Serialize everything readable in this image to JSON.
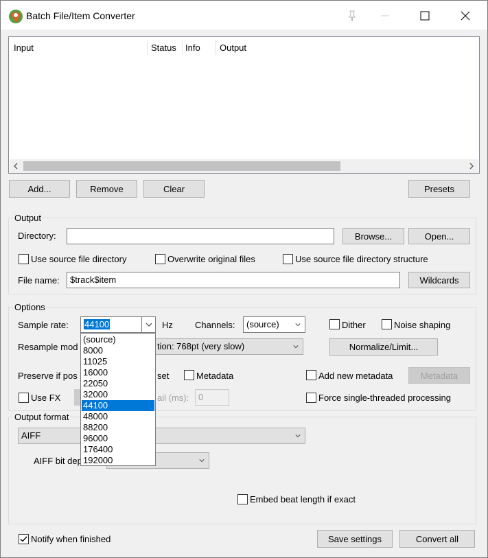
{
  "window": {
    "title": "Batch File/Item Converter"
  },
  "list": {
    "columns": [
      "Input",
      "Status",
      "Info",
      "Output"
    ]
  },
  "list_buttons": {
    "add": "Add...",
    "remove": "Remove",
    "clear": "Clear",
    "presets": "Presets"
  },
  "output": {
    "group_label": "Output",
    "directory_label": "Directory:",
    "directory_value": "",
    "browse": "Browse...",
    "open": "Open...",
    "use_source_dir": "Use source file directory",
    "overwrite": "Overwrite original files",
    "use_source_structure": "Use source file directory structure",
    "filename_label": "File name:",
    "filename_value": "$track$item",
    "wildcards": "Wildcards"
  },
  "options": {
    "group_label": "Options",
    "sample_rate_label": "Sample rate:",
    "sample_rate_value": "44100",
    "hz": "Hz",
    "channels_label": "Channels:",
    "channels_value": "(source)",
    "dither": "Dither",
    "noise_shaping": "Noise shaping",
    "resample_label": "Resample mod",
    "resample_value": "tion: 768pt (very slow)",
    "normalize": "Normalize/Limit...",
    "preserve_label": "Preserve if pos",
    "preserve_suffix": "set",
    "metadata": "Metadata",
    "add_new_metadata": "Add new metadata",
    "metadata_button": "Metadata",
    "use_fx": "Use FX",
    "tail_label": "ail (ms):",
    "tail_value": "0",
    "force_single": "Force single-threaded processing"
  },
  "sample_rate_options": [
    "(source)",
    "8000",
    "11025",
    "16000",
    "22050",
    "32000",
    "44100",
    "48000",
    "88200",
    "96000",
    "176400",
    "192000"
  ],
  "sample_rate_selected_index": 6,
  "output_format": {
    "group_label": "Output format",
    "format_value": "AIFF",
    "bit_depth_label": "AIFF bit dep",
    "embed_beat": "Embed beat length if exact"
  },
  "footer": {
    "notify": "Notify when finished",
    "notify_checked": true,
    "save_settings": "Save settings",
    "convert_all": "Convert all"
  },
  "colors": {
    "selection": "#0078d7",
    "window_bg": "#f0f0f0"
  }
}
